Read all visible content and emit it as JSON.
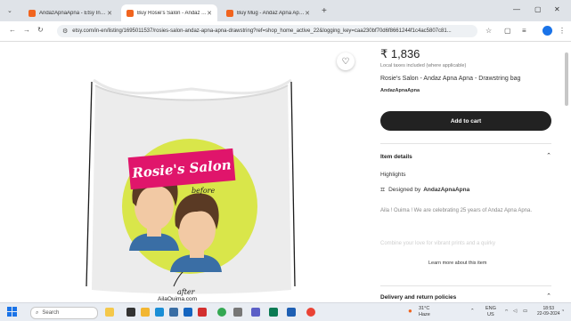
{
  "browser": {
    "tabs": [
      {
        "title": "AndazApnaApna - Etsy India",
        "active": false
      },
      {
        "title": "Buy Rosie's Salon - Andaz Apna Apna",
        "active": true
      },
      {
        "title": "Buy Mug - Andaz Apna Apna Coffee",
        "active": false
      }
    ],
    "url": "etsy.com/in-en/listing/1695011537/rosies-salon-andaz-apna-apna-drawstring?ref=shop_home_active_22&logging_key=caa230bf70d6f8661244f1c4ac5807c81..."
  },
  "product": {
    "price": "₹ 1,836",
    "taxes_note": "Local taxes included (where applicable)",
    "title": "Rosie's Salon - Andaz Apna Apna - Drawstring bag",
    "shop_name": "AndazApnaApna",
    "add_to_cart": "Add to cart",
    "item_details_heading": "Item details",
    "highlights_heading": "Highlights",
    "designed_by_prefix": "Designed by",
    "designed_by_shop": "AndazApnaApna",
    "description": "Aila ! Ouima ! We are celebrating 25 years of Andaz Apna Apna.",
    "description_faded": "Combine your love for vibrant prints and a quirky",
    "learn_more": "Learn more about this item",
    "delivery_heading": "Delivery and return policies"
  },
  "artwork": {
    "banner_text": "Rosie's Salon",
    "before_label": "before",
    "after_label": "after",
    "site_text": "AilaOuima.com"
  },
  "taskbar": {
    "search_placeholder": "Search",
    "weather_temp": "31°C",
    "weather_desc": "Haze",
    "language": "ENG",
    "language_sub": "US",
    "time": "18:53",
    "date": "22-09-2024"
  },
  "colors": {
    "etsy_orange": "#f1641e",
    "cart_button": "#222222",
    "banner_pink": "#e0156b",
    "circle_yellow": "#d9e64a"
  }
}
